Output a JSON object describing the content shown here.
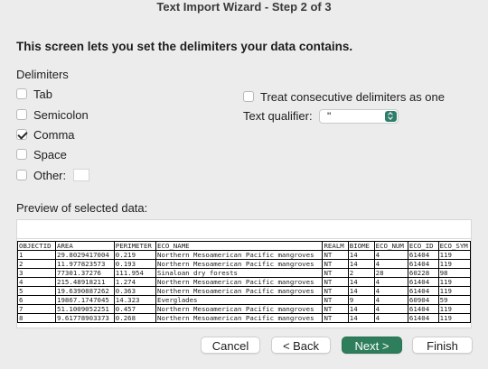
{
  "window": {
    "title": "Text Import Wizard - Step 2 of 3"
  },
  "instruction": "This screen lets you set the delimiters your data contains.",
  "delimiters": {
    "label": "Delimiters",
    "tab": {
      "label": "Tab",
      "checked": false
    },
    "semicolon": {
      "label": "Semicolon",
      "checked": false
    },
    "comma": {
      "label": "Comma",
      "checked": true
    },
    "space": {
      "label": "Space",
      "checked": false
    },
    "other": {
      "label": "Other:",
      "checked": false,
      "value": ""
    }
  },
  "options": {
    "consecutive": {
      "label": "Treat consecutive delimiters as one",
      "checked": false
    },
    "qualifier": {
      "label": "Text qualifier:",
      "value": "\""
    }
  },
  "preview": {
    "label": "Preview of selected data:",
    "headers": [
      "OBJECTID",
      "AREA",
      "PERIMETER",
      "ECO_NAME",
      "REALM",
      "BIOME",
      "ECO_NUM",
      "ECO_ID",
      "ECO_SYM"
    ],
    "rows": [
      [
        "1",
        "29.8029417004",
        "0.219",
        "Northern Mesoamerican Pacific mangroves",
        "NT",
        "14",
        "4",
        "61404",
        "119"
      ],
      [
        "2",
        "11.977823573",
        "0.193",
        "Northern Mesoamerican Pacific mangroves",
        "NT",
        "14",
        "4",
        "61404",
        "119"
      ],
      [
        "3",
        "77301.37276",
        "111.954",
        "Sinaloan dry forests",
        "NT",
        "2",
        "28",
        "60228",
        "98"
      ],
      [
        "4",
        "215.48918211",
        "1.274",
        "Northern Mesoamerican Pacific mangroves",
        "NT",
        "14",
        "4",
        "61404",
        "119"
      ],
      [
        "5",
        "19.6390887262",
        "0.363",
        "Northern Mesoamerican Pacific mangroves",
        "NT",
        "14",
        "4",
        "61404",
        "119"
      ],
      [
        "6",
        "19867.1747045",
        "14.323",
        "Everglades",
        "NT",
        "9",
        "4",
        "60904",
        "59"
      ],
      [
        "7",
        "51.1009052251",
        "0.457",
        "Northern Mesoamerican Pacific mangroves",
        "NT",
        "14",
        "4",
        "61404",
        "119"
      ],
      [
        "8",
        "9.61778903373",
        "0.268",
        "Northern Mesoamerican Pacific mangroves",
        "NT",
        "14",
        "4",
        "61404",
        "119"
      ]
    ]
  },
  "buttons": {
    "cancel": "Cancel",
    "back": "< Back",
    "next": "Next >",
    "finish": "Finish"
  }
}
